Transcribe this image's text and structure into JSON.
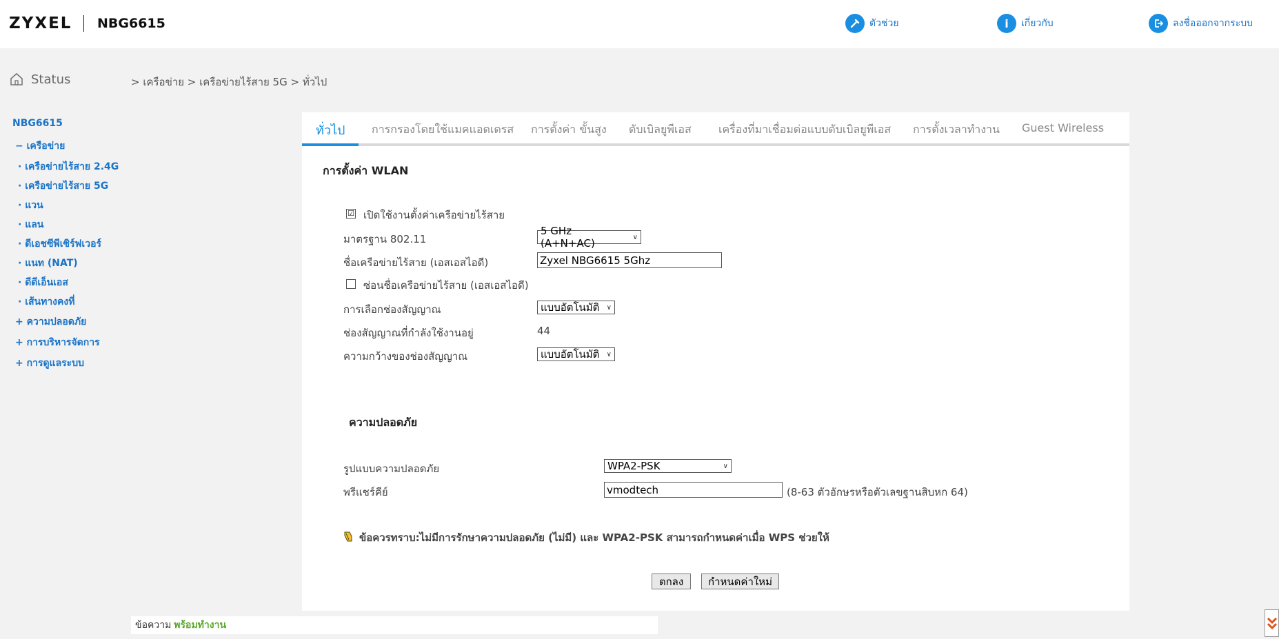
{
  "header": {
    "brand": "ZYXEL",
    "model": "NBG6615",
    "help_label": "ตัวช่วย",
    "about_label": "เกี่ยวกับ",
    "logout_label": "ลงชื่อออกจากระบบ"
  },
  "status": {
    "label": "Status"
  },
  "breadcrumb": "> เครือข่าย > เครือข่ายไร้สาย 5G > ทั่วไป",
  "sidebar": {
    "root": "NBG6615",
    "items": [
      "− เครือข่าย",
      "· เครือข่ายไร้สาย 2.4G",
      "· เครือข่ายไร้สาย 5G",
      "· แวน",
      "· แลน",
      "· ดีเอชซีพีเซิร์ฟเวอร์",
      "· แนท (NAT)",
      "· ดีดีเอ็นเอส",
      "· เส้นทางคงที่",
      "+ ความปลอดภัย",
      "+ การบริหารจัดการ",
      "+ การดูแลระบบ"
    ]
  },
  "tabs": [
    "ทั่วไป",
    "การกรองโดยใช้แมคแอดเดรส",
    "การตั้งค่า ขั้นสูง",
    "ดับเบิลยูพีเอส",
    "เครื่องที่มาเชื่อมต่อแบบดับเบิลยูพีเอส",
    "การตั้งเวลาทำงาน",
    "Guest Wireless"
  ],
  "wlan": {
    "title": "การตั้งค่า WLAN",
    "enable_label": "เปิดใช้งานตั้งค่าเครือข่ายไร้สาย",
    "enable_checked": "☑",
    "standard_label": "มาตรฐาน 802.11",
    "standard_value": "5 GHz (A+N+AC)",
    "ssid_label": "ชื่อเครือข่ายไร้สาย (เอสเอสไอดี)",
    "ssid_value": "Zyxel NBG6615 5Ghz",
    "hide_label": "ซ่อนชื่อเครือข่ายไร้สาย (เอสเอสไอดี)",
    "channel_label": "การเลือกช่องสัญญาณ",
    "channel_value": "แบบอัตโนมัติ",
    "operating_label": "ช่องสัญญาณที่กำลังใช้งานอยู่",
    "operating_value": "44",
    "width_label": "ความกว้างของช่องสัญญาณ",
    "width_value": "แบบอัตโนมัติ"
  },
  "security": {
    "title": "ความปลอดภัย",
    "mode_label": "รูปแบบความปลอดภัย",
    "mode_value": "WPA2-PSK",
    "psk_label": "พรีแชร์คีย์",
    "psk_value": "vmodtech",
    "psk_hint": "(8-63 ตัวอักษรหรือตัวเลขฐานสิบหก 64)",
    "note": "ข้อควรทราบ:ไม่มีการรักษาความปลอดภัย (ไม่มี) และ WPA2-PSK สามารถกำหนดค่าเมื่อ WPS ช่วยให้"
  },
  "buttons": {
    "ok": "ตกลง",
    "reset": "กำหนดค่าใหม่"
  },
  "message": {
    "label": "ข้อความ",
    "value": "พร้อมทำงาน"
  },
  "colors": {
    "accent": "#1a8ee0",
    "link": "#1a73c7",
    "ready": "#5aa82c"
  }
}
